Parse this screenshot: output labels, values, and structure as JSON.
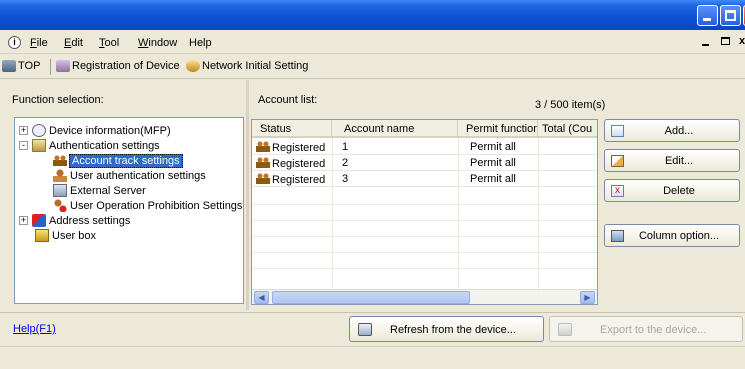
{
  "window": {
    "controls": [
      "minimize",
      "maximize",
      "close"
    ]
  },
  "menu": {
    "items": [
      {
        "label": "File",
        "accel": "F"
      },
      {
        "label": "Edit",
        "accel": "E"
      },
      {
        "label": "Tool",
        "accel": "T"
      },
      {
        "label": "Window",
        "accel": "W"
      },
      {
        "label": "Help"
      }
    ]
  },
  "toolbar": {
    "top_label": "TOP",
    "registration_label": "Registration of Device",
    "network_label": "Network Initial Setting"
  },
  "function_panel": {
    "label": "Function selection:",
    "tree": [
      {
        "label": "Device information(MFP)",
        "icon": "info-icon",
        "expander": "+"
      },
      {
        "label": "Authentication settings",
        "icon": "auth-icon",
        "expander": "-"
      },
      {
        "label": "Account track settings",
        "icon": "account-icon",
        "selected": true
      },
      {
        "label": "User authentication settings",
        "icon": "user-icon"
      },
      {
        "label": "External Server",
        "icon": "server-icon"
      },
      {
        "label": "User Operation Prohibition Settings",
        "icon": "prohibit-icon"
      },
      {
        "label": "Address settings",
        "icon": "address-icon",
        "expander": "+"
      },
      {
        "label": "User box",
        "icon": "box-icon"
      }
    ]
  },
  "account_list": {
    "label": "Account list:",
    "count": "3 / 500 item(s)",
    "columns": [
      "Status",
      "Account name",
      "Permit function",
      "Total (Cou"
    ],
    "rows": [
      {
        "status": "Registered",
        "name": "1",
        "permit": "Permit all",
        "total": ""
      },
      {
        "status": "Registered",
        "name": "2",
        "permit": "Permit all",
        "total": ""
      },
      {
        "status": "Registered",
        "name": "3",
        "permit": "Permit all",
        "total": ""
      }
    ]
  },
  "actions": {
    "add": "Add...",
    "edit": "Edit...",
    "delete": "Delete",
    "column_option": "Column option..."
  },
  "footer": {
    "help": "Help(F1)",
    "refresh": "Refresh from the device...",
    "export": "Export to the device..."
  }
}
